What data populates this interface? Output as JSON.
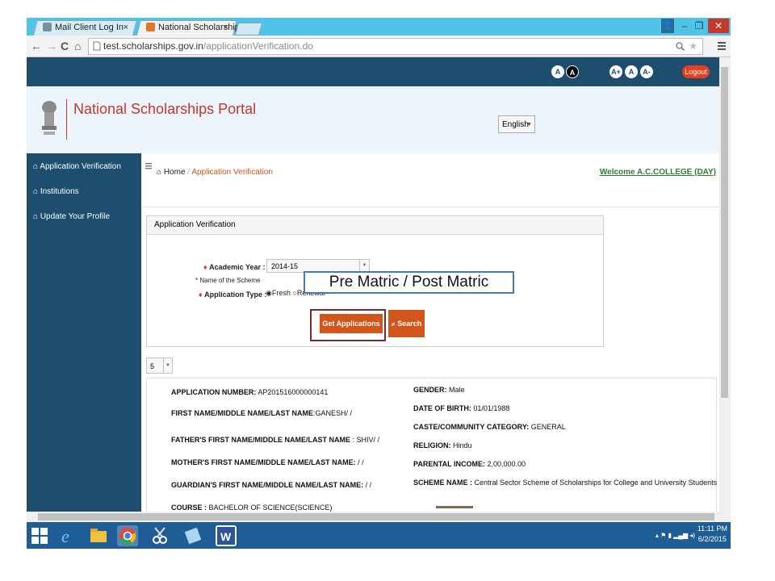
{
  "browser": {
    "tabs": [
      {
        "title": "Mail Client Log In",
        "active": false
      },
      {
        "title": "National Scholarships Por",
        "active": true
      }
    ],
    "close_glyph": "×",
    "window_controls": {
      "minimize": "–",
      "restore": "❐",
      "close": "✕"
    },
    "url_host": "test.scholarships.gov.in",
    "url_path": "/applicationVerification.do",
    "nav": {
      "back": "←",
      "forward": "→",
      "reload": "C",
      "home": "⌂"
    }
  },
  "site": {
    "font_buttons": [
      "A",
      "A"
    ],
    "size_buttons": [
      "A+",
      "A",
      "A-"
    ],
    "logout_label": "Logout",
    "portal_title": "National Scholarships Portal",
    "language": "English",
    "sidebar": [
      {
        "label": "Application Verification"
      },
      {
        "label": "Institutions"
      },
      {
        "label": "Update Your Profile"
      }
    ],
    "breadcrumb": {
      "home": "Home",
      "separator": "/",
      "current": "Application Verification"
    },
    "welcome": "Welcome A.C.COLLEGE (DAY)",
    "panel": {
      "title": "Application Verification",
      "academic_year_label": "Academic Year :",
      "academic_year_value": "2014-15",
      "scheme_label": "* Name of the Scheme",
      "app_type_label": "Application Type :",
      "app_type_options": [
        "Fresh",
        "Renewal"
      ],
      "get_applications_label": "Get Applications",
      "search_label": "Search"
    },
    "page_size": "5",
    "record": {
      "left": [
        {
          "label": "APPLICATION NUMBER:",
          "value": "AP201516000000141"
        },
        {
          "label": "FIRST NAME/MIDDLE NAME/LAST NAME",
          "value": ":GANESH/ /"
        },
        {
          "label": "FATHER'S FIRST NAME/MIDDLE NAME/LAST NAME",
          "value": ":  SHIV/ /"
        },
        {
          "label": "MOTHER'S FIRST NAME/MIDDLE NAME/LAST NAME:",
          "value": "/ /"
        },
        {
          "label": "GUARDIAN'S FIRST NAME/MIDDLE NAME/LAST NAME:",
          "value": "/ /"
        },
        {
          "label": "COURSE :",
          "value": "BACHELOR OF SCIENCE(SCIENCE)"
        }
      ],
      "right": [
        {
          "label": "GENDER:",
          "value": "Male"
        },
        {
          "label": "DATE OF BIRTH:",
          "value": "01/01/1988"
        },
        {
          "label": "CASTE/COMMUNITY CATEGORY:",
          "value": "GENERAL"
        },
        {
          "label": "RELIGION:",
          "value": "Hindu"
        },
        {
          "label": "PARENTAL INCOME:",
          "value": "2,00,000.00"
        },
        {
          "label": "SCHEME NAME :",
          "value": "Central Sector Scheme of Scholarships for College and University Students"
        }
      ]
    }
  },
  "overlay_text": "Pre Matric / Post Matric",
  "taskbar": {
    "time": "11:11 PM",
    "date": "6/2/2015"
  },
  "colors": {
    "site_navy": "#1d4e6e",
    "accent_orange": "#d2561b",
    "welcome_green": "#2e7d32",
    "taskbar_blue": "#1e5d96"
  }
}
